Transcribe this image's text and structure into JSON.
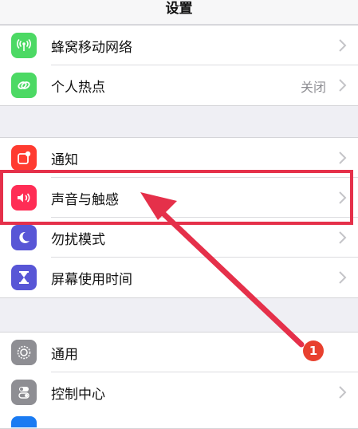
{
  "navbar": {
    "title": "设置"
  },
  "group1": {
    "items": [
      {
        "label": "蜂窝移动网络",
        "icon": "cellular-antenna-icon",
        "color": "#4cd964",
        "value": ""
      },
      {
        "label": "个人热点",
        "icon": "personal-hotspot-icon",
        "color": "#4cd964",
        "value": "关闭"
      }
    ]
  },
  "group2": {
    "items": [
      {
        "label": "通知",
        "icon": "notifications-icon",
        "color": "#ff3b30"
      },
      {
        "label": "声音与触感",
        "icon": "speaker-sound-icon",
        "color": "#ff2d55"
      },
      {
        "label": "勿扰模式",
        "icon": "moon-icon",
        "color": "#5856d6"
      },
      {
        "label": "屏幕使用时间",
        "icon": "hourglass-icon",
        "color": "#5856d6"
      }
    ]
  },
  "group3": {
    "items": [
      {
        "label": "通用",
        "icon": "gear-icon",
        "color": "#8e8e93"
      },
      {
        "label": "控制中心",
        "icon": "control-center-toggles-icon",
        "color": "#8e8e93"
      }
    ]
  },
  "annotation": {
    "step_badge": "1",
    "highlight_color": "#e5304a"
  }
}
